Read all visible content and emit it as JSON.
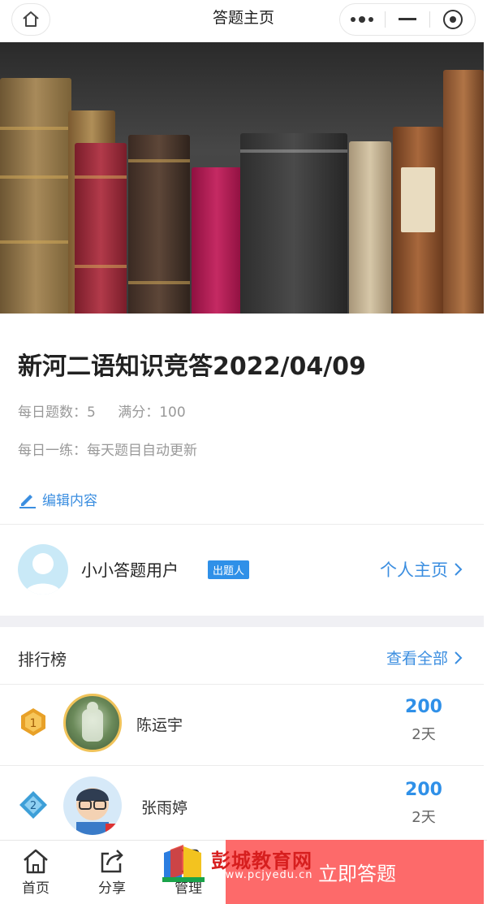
{
  "nav": {
    "title": "答题主页"
  },
  "quiz": {
    "title": "新河二语知识竞答2022/04/09",
    "daily_count_label": "每日题数：5",
    "full_score_label": "满分：100",
    "description": "每日一练：每天题目自动更新",
    "edit_label": "编辑内容"
  },
  "author": {
    "name": "小小答题用户",
    "badge": "出题人",
    "profile_link": "个人主页"
  },
  "ranking": {
    "title": "排行榜",
    "view_all": "查看全部",
    "entries": [
      {
        "rank": "1",
        "name": "陈运宇",
        "score": "200",
        "days": "2天"
      },
      {
        "rank": "2",
        "name": "张雨婷",
        "score": "200",
        "days": "2天"
      }
    ]
  },
  "tabbar": {
    "home": "首页",
    "share": "分享",
    "manage": "管理",
    "start_button": "立即答题"
  },
  "watermark": {
    "text": "彭城教育网",
    "url": "www.pcjyedu.cn"
  },
  "colors": {
    "accent": "#3b8ee0",
    "button": "#fd6a6a",
    "badge": "#2f90e8"
  }
}
